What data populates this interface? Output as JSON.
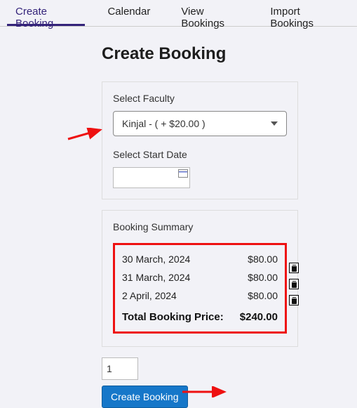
{
  "tabs": {
    "create": "Create Booking",
    "calendar": "Calendar",
    "view": "View Bookings",
    "import": "Import Bookings"
  },
  "page_title": "Create Booking",
  "form": {
    "faculty_label": "Select Faculty",
    "faculty_value": "Kinjal - ( + $20.00 )",
    "date_label": "Select Start Date"
  },
  "summary": {
    "title": "Booking Summary",
    "rows": [
      {
        "date": "30 March, 2024",
        "price": "$80.00"
      },
      {
        "date": "31 March, 2024",
        "price": "$80.00"
      },
      {
        "date": "2 April, 2024",
        "price": "$80.00"
      }
    ],
    "total_label": "Total Booking Price:",
    "total_value": "$240.00"
  },
  "qty_value": "1",
  "submit_label": "Create Booking"
}
